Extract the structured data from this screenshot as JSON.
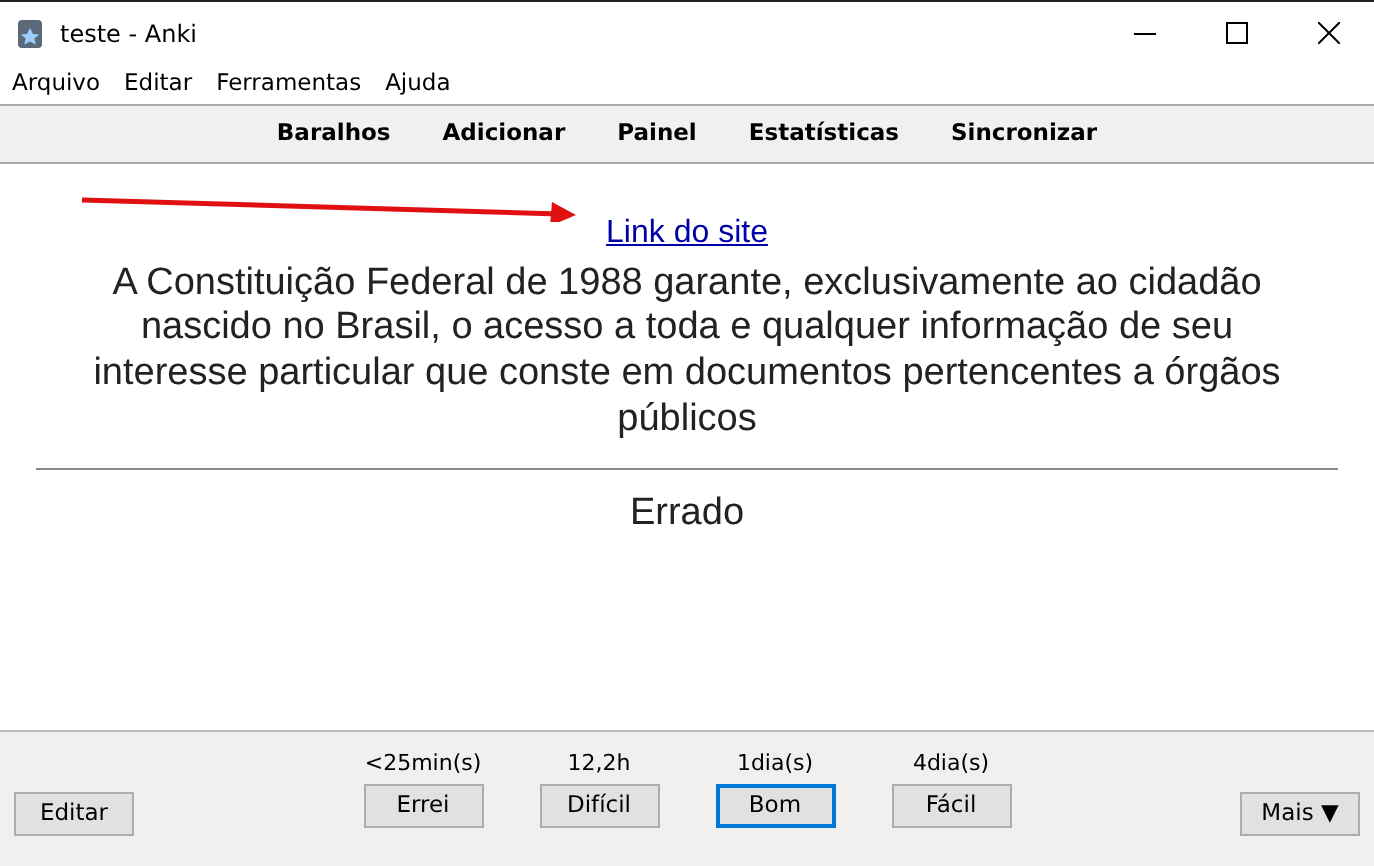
{
  "window": {
    "title": "teste - Anki"
  },
  "menu": [
    "Arquivo",
    "Editar",
    "Ferramentas",
    "Ajuda"
  ],
  "toolbar": [
    "Baralhos",
    "Adicionar",
    "Painel",
    "Estatísticas",
    "Sincronizar"
  ],
  "card": {
    "link": "Link do site",
    "question": "A Constituição Federal de 1988 garante, exclusivamente ao cidadão nascido no Brasil, o acesso a toda e qualquer informação de seu interesse particular que conste em documentos pertencentes a órgãos públicos",
    "answer": "Errado"
  },
  "bottom": {
    "edit_button": "Editar",
    "more_button": "Mais ▼",
    "answers": [
      {
        "interval": "<25min(s)",
        "label": "Errei",
        "selected": false
      },
      {
        "interval": "12,2h",
        "label": "Difícil",
        "selected": false
      },
      {
        "interval": "1dia(s)",
        "label": "Bom",
        "selected": true
      },
      {
        "interval": "4dia(s)",
        "label": "Fácil",
        "selected": false
      }
    ]
  }
}
